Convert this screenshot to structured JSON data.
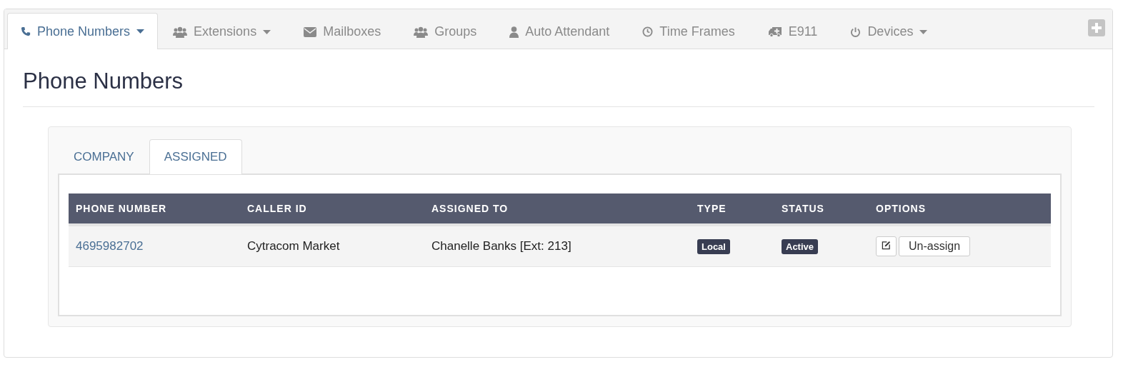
{
  "nav_tabs": [
    {
      "label": "Phone Numbers",
      "selected": true,
      "dropdown": true
    },
    {
      "label": "Extensions",
      "selected": false,
      "dropdown": true
    },
    {
      "label": "Mailboxes",
      "selected": false,
      "dropdown": false
    },
    {
      "label": "Groups",
      "selected": false,
      "dropdown": false
    },
    {
      "label": "Auto Attendant",
      "selected": false,
      "dropdown": false
    },
    {
      "label": "Time Frames",
      "selected": false,
      "dropdown": false
    },
    {
      "label": "E911",
      "selected": false,
      "dropdown": false
    },
    {
      "label": "Devices",
      "selected": false,
      "dropdown": true
    }
  ],
  "page_title": "Phone Numbers",
  "sub_tabs": [
    {
      "label": "COMPANY",
      "selected": false
    },
    {
      "label": "ASSIGNED",
      "selected": true
    }
  ],
  "table": {
    "columns": [
      "PHONE NUMBER",
      "CALLER ID",
      "ASSIGNED TO",
      "TYPE",
      "STATUS",
      "OPTIONS"
    ],
    "rows": [
      {
        "phone_number": "4695982702",
        "caller_id": "Cytracom Market",
        "assigned_to": "Chanelle Banks [Ext: 213]",
        "type": "Local",
        "status": "Active",
        "unassign_button": "Un-assign"
      }
    ]
  }
}
